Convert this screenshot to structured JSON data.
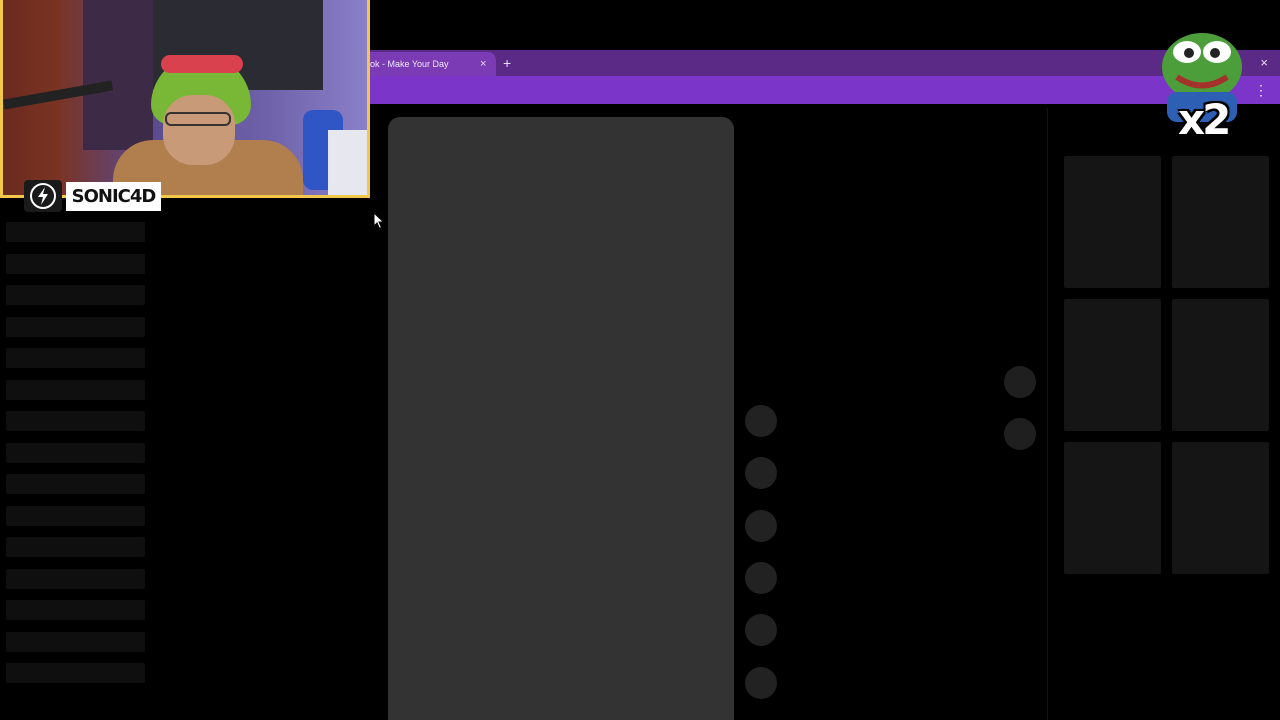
{
  "browser": {
    "tab_title": "ok - Make Your Day",
    "tab_close": "×",
    "new_tab": "+",
    "window_close": "×",
    "menu": "⋮",
    "accent_colors": {
      "tabbar": "#5b2a86",
      "toolbar": "#7b35c8"
    }
  },
  "webcam": {
    "name_plate": "SONIC4D",
    "border_color": "#f1c84b",
    "logo_icon": "lightning-bolt-icon"
  },
  "emote": {
    "text": "x2",
    "icon": "pepe-frog-emote"
  },
  "skeleton": {
    "left_list_rows": 15,
    "action_buttons": 6,
    "side_buttons": 2,
    "grid_cards": 6
  }
}
